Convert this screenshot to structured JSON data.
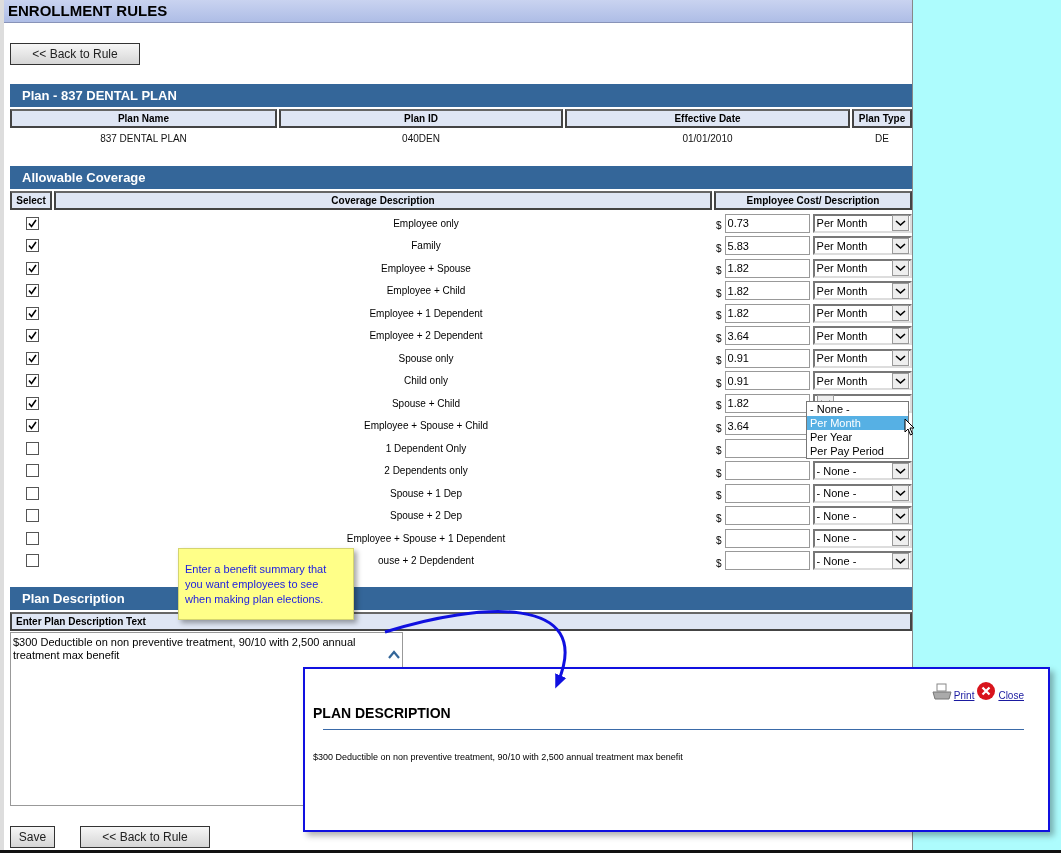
{
  "page_title": "ENROLLMENT RULES",
  "back_button": "<< Back to Rule",
  "plan": {
    "title": "Plan  -  837 DENTAL PLAN",
    "columns": [
      "Plan Name",
      "Plan ID",
      "Effective Date",
      "Plan Type"
    ],
    "values": [
      "837 DENTAL PLAN",
      "040DEN",
      "01/01/2010",
      "DE"
    ]
  },
  "coverage": {
    "title": "Allowable Coverage",
    "columns": [
      "Select",
      "Coverage Description",
      "Employee Cost/ Description"
    ],
    "currency": "$",
    "rows": [
      {
        "checked": true,
        "description": "Employee only",
        "amount": "0.73",
        "unit": "Per Month"
      },
      {
        "checked": true,
        "description": "Family",
        "amount": "5.83",
        "unit": "Per Month"
      },
      {
        "checked": true,
        "description": "Employee + Spouse",
        "amount": "1.82",
        "unit": "Per Month"
      },
      {
        "checked": true,
        "description": "Employee + Child",
        "amount": "1.82",
        "unit": "Per Month"
      },
      {
        "checked": true,
        "description": "Employee + 1 Dependent",
        "amount": "1.82",
        "unit": "Per Month"
      },
      {
        "checked": true,
        "description": "Employee + 2 Dependent",
        "amount": "3.64",
        "unit": "Per Month"
      },
      {
        "checked": true,
        "description": "Spouse only",
        "amount": "0.91",
        "unit": "Per Month"
      },
      {
        "checked": true,
        "description": "Child only",
        "amount": "0.91",
        "unit": "Per Month"
      },
      {
        "checked": true,
        "description": "Spouse + Child",
        "amount": "1.82",
        "dropdown": [
          {
            "label": "- None -",
            "selected": false
          },
          {
            "label": "Per Month",
            "selected": true
          },
          {
            "label": "Per Year",
            "selected": false
          },
          {
            "label": "Per Pay Period",
            "selected": false
          }
        ]
      },
      {
        "checked": true,
        "description": "Employee + Spouse + Child",
        "amount": "3.64"
      },
      {
        "checked": false,
        "description": "1 Dependent Only"
      },
      {
        "checked": false,
        "description": "2 Dependents  only",
        "unit": "- None -"
      },
      {
        "checked": false,
        "description": "Spouse + 1 Dep",
        "unit": "- None -"
      },
      {
        "checked": false,
        "description": "Spouse + 2 Dep",
        "unit": "- None -"
      },
      {
        "checked": false,
        "description": "Employee + Spouse + 1 Dependent",
        "unit": "- None -"
      },
      {
        "checked": false,
        "description": "ouse + 2 Depdendent",
        "unit": "- None -"
      }
    ]
  },
  "description": {
    "title": "Plan Description",
    "label": "Enter Plan Description Text",
    "text": "$300 Deductible on non preventive treatment, 90/10 with 2,500 annual treatment max benefit"
  },
  "callout": "Enter a benefit summary that you want employees to see when making plan elections.",
  "popup": {
    "print": "Print",
    "close": "Close",
    "title": "PLAN DESCRIPTION",
    "text": "$300 Deductible on non preventive treatment, 90/10 with 2,500 annual treatment max benefit"
  },
  "buttons": [
    "Save",
    "<< Back to Rule"
  ]
}
